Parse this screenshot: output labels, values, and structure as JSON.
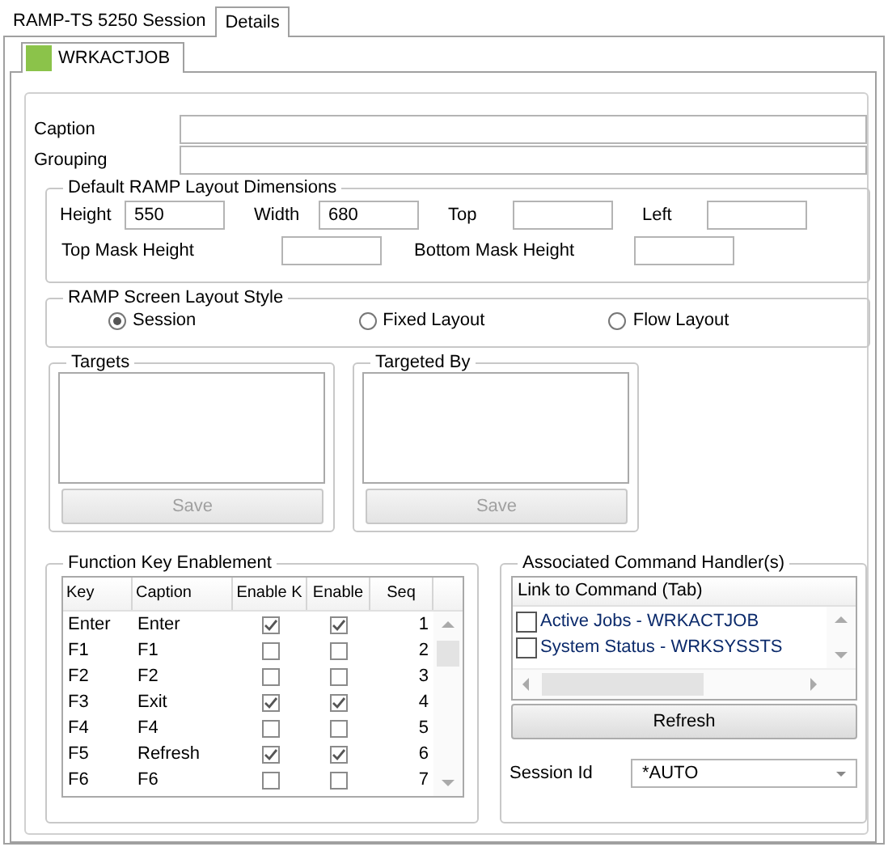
{
  "tabs": [
    {
      "label": "RAMP-TS 5250 Session",
      "selected": false
    },
    {
      "label": "Details",
      "selected": true
    }
  ],
  "inner_tabs": [
    {
      "label": "WRKACTJOB",
      "selected": true
    }
  ],
  "fields": [
    {
      "label": "Caption"
    },
    {
      "label": "Grouping"
    }
  ],
  "layout_dimensions": {
    "title": "Default RAMP Layout Dimensions",
    "fields": [
      {
        "label": "Height",
        "value": "550"
      },
      {
        "label": "Width",
        "value": "680"
      },
      {
        "label": "Top"
      },
      {
        "label": "Left"
      },
      {
        "label": "Top Mask Height"
      },
      {
        "label": "Bottom Mask Height"
      }
    ]
  },
  "layout_style": {
    "title": "RAMP Screen Layout Style",
    "options": [
      {
        "label": "Session",
        "selected": true
      },
      {
        "label": "Fixed Layout",
        "selected": false
      },
      {
        "label": "Flow Layout",
        "selected": false
      }
    ]
  },
  "targets": {
    "title": "Targets",
    "button": {
      "label": "Save",
      "disabled": true
    }
  },
  "targeted_by": {
    "title": "Targeted By",
    "button": {
      "label": "Save",
      "disabled": true
    }
  },
  "function_keys": {
    "title": "Function Key Enablement",
    "columns": [
      "Key",
      "Caption",
      "Enable K",
      "Enable",
      "Seq"
    ],
    "rows": [
      {
        "key": "Enter",
        "caption": "Enter",
        "enable_key": true,
        "column_4": true,
        "seq": "1"
      },
      {
        "key": "F1",
        "caption": "F1",
        "enable_key": false,
        "column_4": false,
        "seq": "2"
      },
      {
        "key": "F2",
        "caption": "F2",
        "enable_key": false,
        "column_4": false,
        "seq": "3"
      },
      {
        "key": "F3",
        "caption": "Exit",
        "enable_key": true,
        "column_4": true,
        "seq": "4"
      },
      {
        "key": "F4",
        "caption": "F4",
        "enable_key": false,
        "column_4": false,
        "seq": "5"
      },
      {
        "key": "F5",
        "caption": "Refresh",
        "enable_key": true,
        "column_4": true,
        "seq": "6"
      },
      {
        "key": "F6",
        "caption": "F6",
        "enable_key": false,
        "column_4": false,
        "seq": "7"
      }
    ]
  },
  "command_handlers": {
    "title": "Associated Command Handler(s)",
    "column": "Link to Command (Tab)",
    "items": [
      {
        "label": "Active Jobs - WRKACTJOB",
        "checked": false
      },
      {
        "label": "System Status - WRKSYSSTS",
        "checked": false
      }
    ],
    "button": {
      "label": "Refresh",
      "disabled": false
    },
    "session_label": "Session Id",
    "session_value": "*AUTO"
  }
}
